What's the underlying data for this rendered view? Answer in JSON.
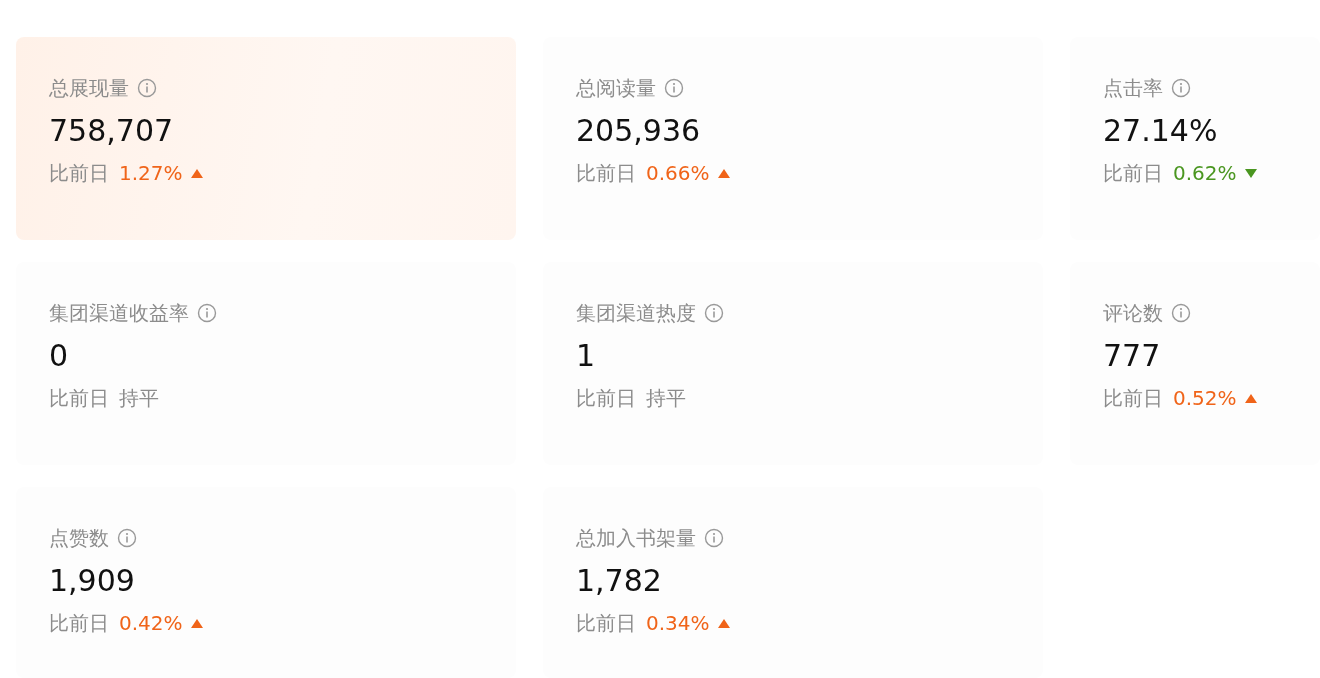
{
  "cards": [
    {
      "label": "总展现量",
      "value": "758,707",
      "compare_label": "比前日",
      "change": "1.27%",
      "kind": "up",
      "selected": true
    },
    {
      "label": "总阅读量",
      "value": "205,936",
      "compare_label": "比前日",
      "change": "0.66%",
      "kind": "up",
      "selected": false
    },
    {
      "label": "点击率",
      "value": "27.14%",
      "compare_label": "比前日",
      "change": "0.62%",
      "kind": "down",
      "selected": false
    },
    {
      "label": "集团渠道收益率",
      "value": "0",
      "compare_label": "比前日",
      "change": "持平",
      "kind": "flat",
      "selected": false
    },
    {
      "label": "集团渠道热度",
      "value": "1",
      "compare_label": "比前日",
      "change": "持平",
      "kind": "flat",
      "selected": false
    },
    {
      "label": "评论数",
      "value": "777",
      "compare_label": "比前日",
      "change": "0.52%",
      "kind": "up",
      "selected": false
    },
    {
      "label": "点赞数",
      "value": "1,909",
      "compare_label": "比前日",
      "change": "0.42%",
      "kind": "up",
      "selected": false
    },
    {
      "label": "总加入书架量",
      "value": "1,782",
      "compare_label": "比前日",
      "change": "0.34%",
      "kind": "up",
      "selected": false
    }
  ]
}
